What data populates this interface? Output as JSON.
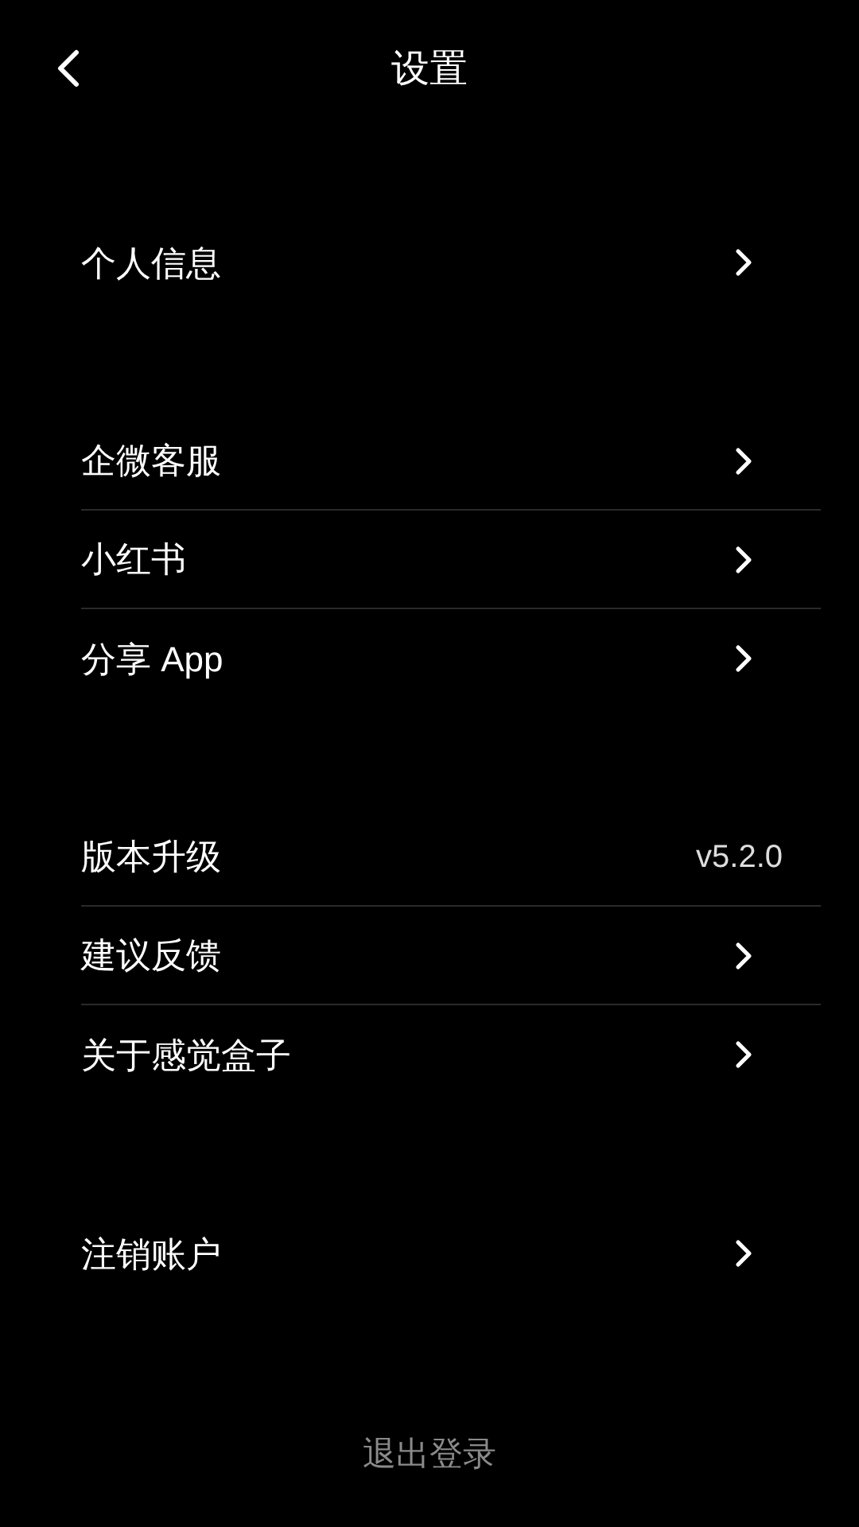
{
  "header": {
    "title": "设置"
  },
  "groups": [
    {
      "items": [
        {
          "kind": "link",
          "label": "个人信息"
        }
      ]
    },
    {
      "items": [
        {
          "kind": "link",
          "label": "企微客服"
        },
        {
          "kind": "link",
          "label": "小红书"
        },
        {
          "kind": "link",
          "label": "分享 App"
        }
      ]
    },
    {
      "items": [
        {
          "kind": "value",
          "label": "版本升级",
          "value": "v5.2.0"
        },
        {
          "kind": "link",
          "label": "建议反馈"
        },
        {
          "kind": "link",
          "label": "关于感觉盒子"
        }
      ]
    },
    {
      "items": [
        {
          "kind": "link",
          "label": "注销账户"
        }
      ]
    }
  ],
  "logout": {
    "label": "退出登录"
  }
}
